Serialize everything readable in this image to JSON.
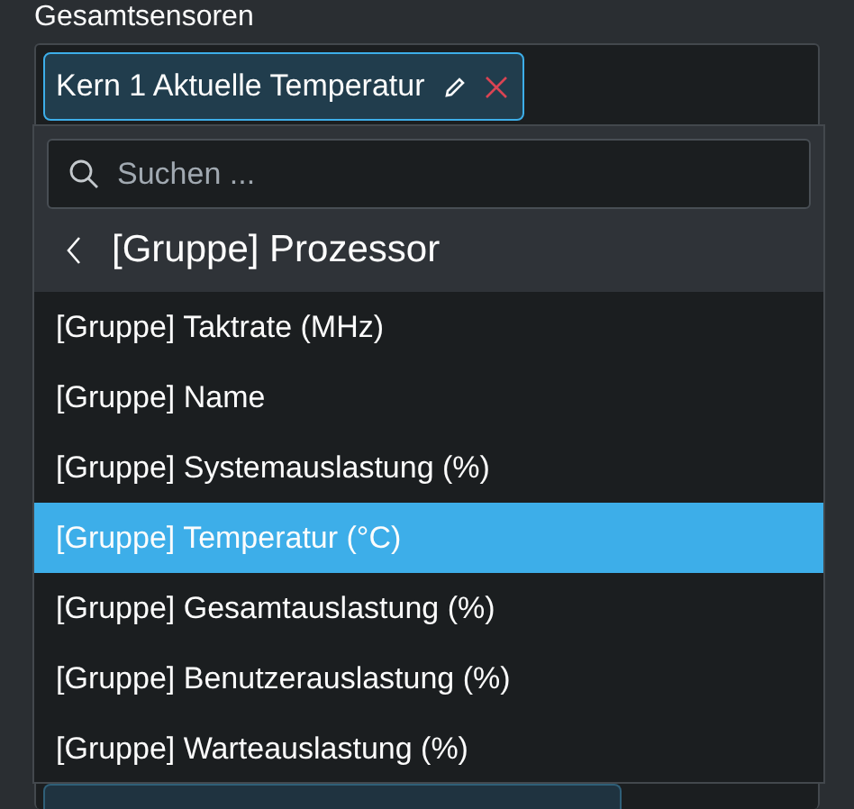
{
  "field_label": "Gesamtsensoren",
  "chips": [
    {
      "label": "Kern 1 Aktuelle Temperatur",
      "kind": "full"
    },
    {
      "kind": "hidden"
    }
  ],
  "popup": {
    "search": {
      "placeholder": "Suchen ..."
    },
    "back_title": "[Gruppe] Prozessor",
    "items": [
      {
        "label": "[Gruppe] Taktrate (MHz)",
        "selected": false
      },
      {
        "label": "[Gruppe] Name",
        "selected": false
      },
      {
        "label": "[Gruppe] Systemauslastung (%)",
        "selected": false
      },
      {
        "label": "[Gruppe] Temperatur (°C)",
        "selected": true
      },
      {
        "label": "[Gruppe] Gesamtauslastung (%)",
        "selected": false
      },
      {
        "label": "[Gruppe] Benutzerauslastung (%)",
        "selected": false
      },
      {
        "label": "[Gruppe] Warteauslastung (%)",
        "selected": false
      }
    ]
  }
}
